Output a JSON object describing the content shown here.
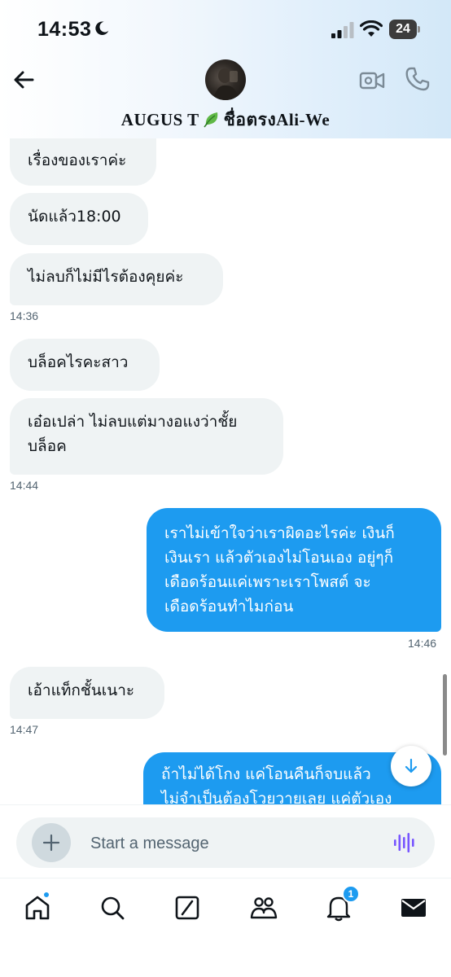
{
  "status_bar": {
    "time": "14:53",
    "battery": "24"
  },
  "header": {
    "contact_name": "AUGUS T",
    "contact_name_suffix": "ชื่อตรงAli-We"
  },
  "messages": [
    {
      "direction": "in",
      "text": "เรื่องของเราค่ะ"
    },
    {
      "direction": "in",
      "text": "นัดแล้ว18:00"
    },
    {
      "direction": "in",
      "text": "ไม่ลบก็ไม่มีไรต้องคุยค่ะ",
      "timestamp": "14:36"
    },
    {
      "direction": "in",
      "text": "บล็อคไรคะสาว"
    },
    {
      "direction": "in",
      "text": "เอ๋อเปล่า ไม่ลบแต่มางอแงว่าชั้ย\nบล็อค",
      "timestamp": "14:44"
    },
    {
      "direction": "out",
      "text": "เราไม่เข้าใจว่าเราผิดอะไรค่ะ เงินก็\nเงินเรา แล้วตัวเองไม่โอนเอง อยู่ๆก็\nเดือดร้อนแค่เพราะเราโพสต์ จะ\nเดือดร้อนทำไมก่อน",
      "timestamp": "14:46"
    },
    {
      "direction": "in",
      "text": "เอ้าแท็กชั้นเนาะ",
      "timestamp": "14:47"
    },
    {
      "direction": "out",
      "text": "ถ้าไม่ได้โกง แค่โอนคืนก็จบแล้ว\nไม่จำเป็นต้องโวยวายเลย แค่ตัวเอง"
    }
  ],
  "composer": {
    "placeholder": "Start a message"
  },
  "tabbar": {
    "notifications_count": "1"
  },
  "colors": {
    "accent": "#1d9bf0",
    "incoming_bubble": "#eff3f4",
    "voice_icon": "#7856ff"
  }
}
